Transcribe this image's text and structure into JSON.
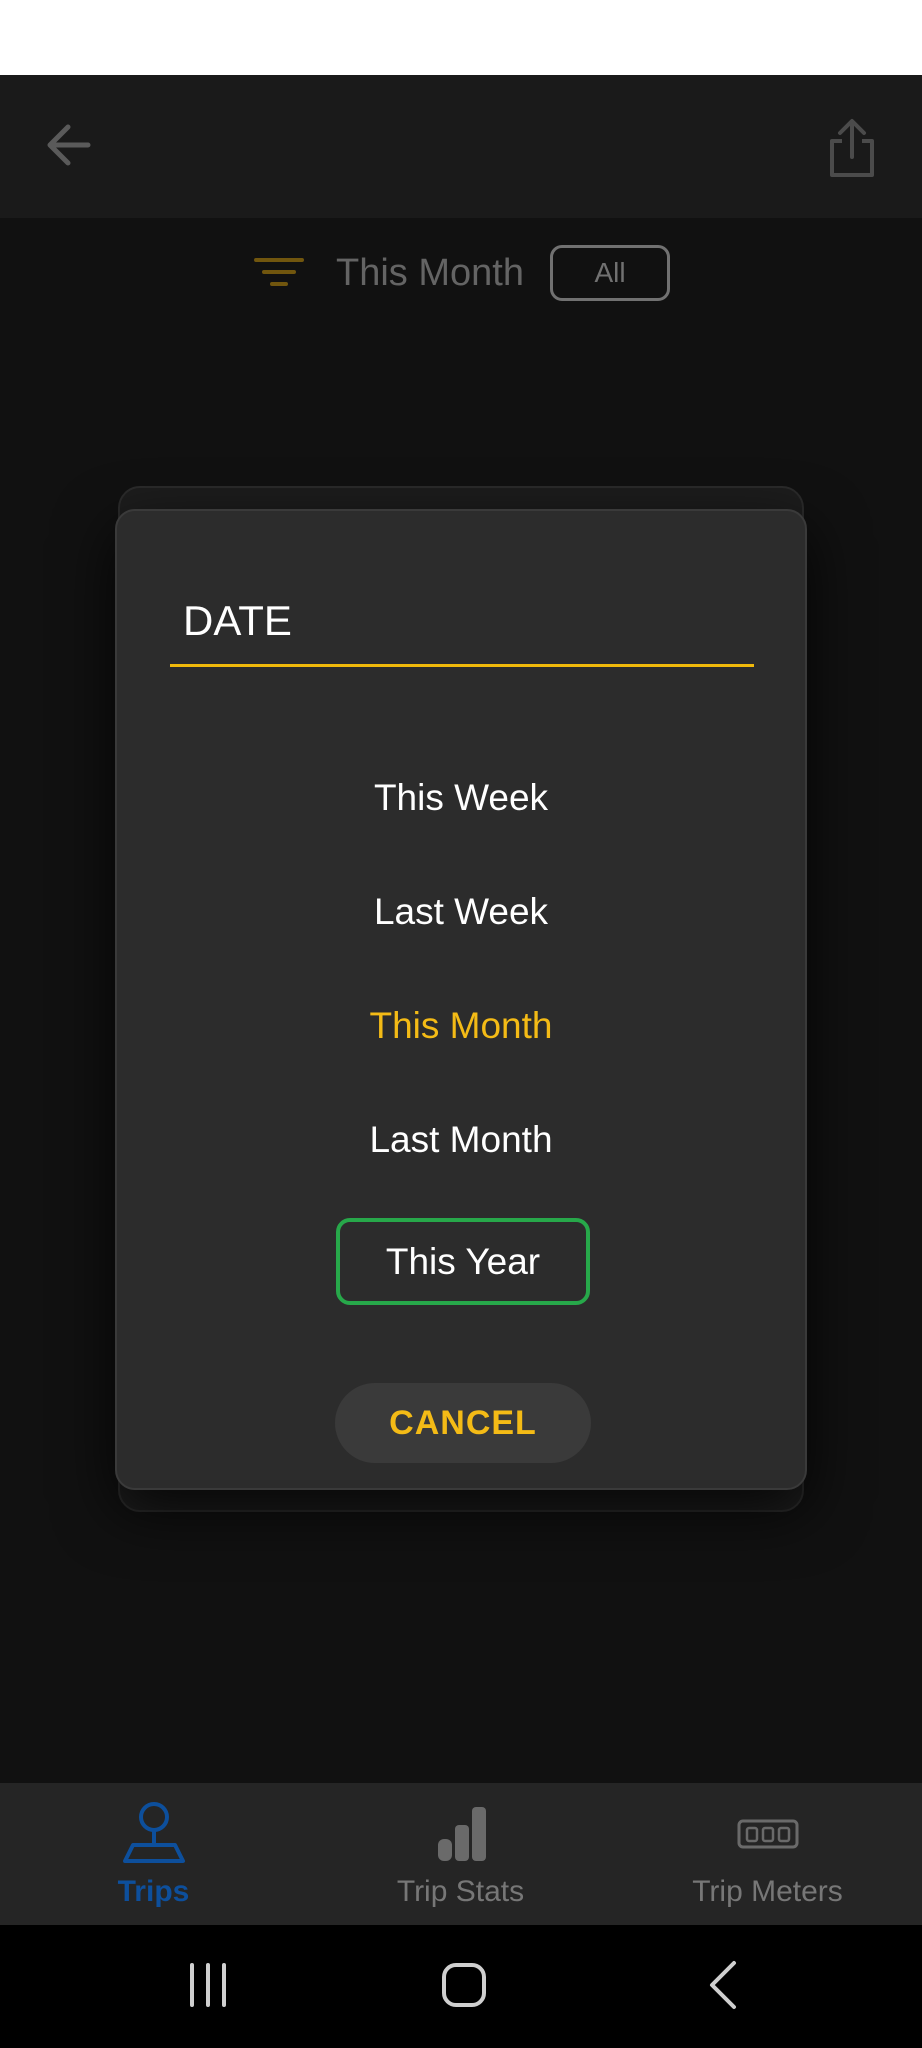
{
  "header": {
    "back_icon": "arrow-left-icon",
    "share_icon": "share-icon"
  },
  "filter": {
    "icon": "filter-icon",
    "label": "This Month",
    "all_button": "All"
  },
  "dialog": {
    "title": "DATE",
    "options": [
      {
        "label": "This Week",
        "state": "normal"
      },
      {
        "label": "Last Week",
        "state": "normal"
      },
      {
        "label": "This Month",
        "state": "selected"
      },
      {
        "label": "Last Month",
        "state": "normal"
      },
      {
        "label": "This Year",
        "state": "focused"
      }
    ],
    "cancel_label": "CANCEL"
  },
  "bottom_nav": {
    "items": [
      {
        "label": "Trips",
        "icon": "trip-pin-icon",
        "active": true
      },
      {
        "label": "Trip Stats",
        "icon": "bar-chart-icon",
        "active": false
      },
      {
        "label": "Trip Meters",
        "icon": "odometer-icon",
        "active": false
      }
    ]
  },
  "system_nav": {
    "recent_icon": "recent-apps-icon",
    "home_icon": "home-icon",
    "back_icon": "back-chevron-icon"
  },
  "colors": {
    "accent": "#f4bb16",
    "focus": "#27a84a",
    "active_nav": "#0d4f9c",
    "dialog_bg": "#2c2c2c"
  }
}
